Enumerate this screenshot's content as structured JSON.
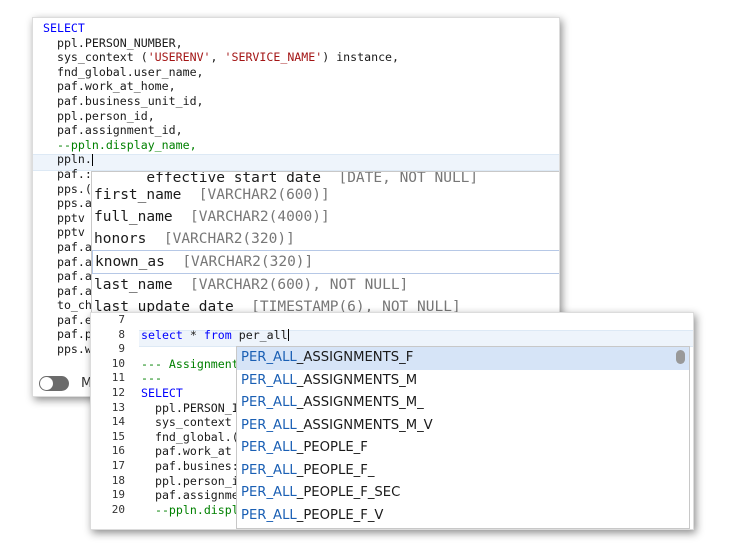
{
  "editor1": {
    "lines": [
      {
        "parts": [
          {
            "t": "SELECT",
            "c": "kw"
          }
        ]
      },
      {
        "parts": [
          {
            "t": "  ppl.PERSON_NUMBER,",
            "c": ""
          }
        ]
      },
      {
        "parts": [
          {
            "t": "  sys_context (",
            "c": ""
          },
          {
            "t": "'USERENV'",
            "c": "str"
          },
          {
            "t": ", ",
            "c": ""
          },
          {
            "t": "'SERVICE_NAME'",
            "c": "str"
          },
          {
            "t": ") instance,",
            "c": ""
          }
        ]
      },
      {
        "parts": [
          {
            "t": "  fnd_global.user_name,",
            "c": ""
          }
        ]
      },
      {
        "parts": [
          {
            "t": "  paf.work_at_home,",
            "c": ""
          }
        ]
      },
      {
        "parts": [
          {
            "t": "  paf.business_unit_id,",
            "c": ""
          }
        ]
      },
      {
        "parts": [
          {
            "t": "  ppl.person_id,",
            "c": ""
          }
        ]
      },
      {
        "parts": [
          {
            "t": "  paf.assignment_id,",
            "c": ""
          }
        ]
      },
      {
        "parts": [
          {
            "t": "  --ppln.display_name,",
            "c": "cm"
          }
        ]
      },
      {
        "parts": [
          {
            "t": "  ppln.",
            "c": ""
          }
        ]
      },
      {
        "parts": [
          {
            "t": "  paf.:",
            "c": ""
          }
        ]
      },
      {
        "parts": [
          {
            "t": "  pps.(",
            "c": ""
          }
        ]
      },
      {
        "parts": [
          {
            "t": "  pps.a",
            "c": ""
          }
        ]
      },
      {
        "parts": [
          {
            "t": "  pptv",
            "c": ""
          }
        ]
      },
      {
        "parts": [
          {
            "t": "  pptv",
            "c": ""
          }
        ]
      },
      {
        "parts": [
          {
            "t": "  paf.a",
            "c": ""
          }
        ]
      },
      {
        "parts": [
          {
            "t": "  paf.a",
            "c": ""
          }
        ]
      },
      {
        "parts": [
          {
            "t": "  paf.a",
            "c": ""
          }
        ]
      },
      {
        "parts": [
          {
            "t": "  paf.a",
            "c": ""
          }
        ]
      },
      {
        "parts": [
          {
            "t": "  to_ch",
            "c": ""
          }
        ]
      },
      {
        "parts": [
          {
            "t": "  paf.e",
            "c": ""
          }
        ]
      },
      {
        "parts": [
          {
            "t": "  paf.p",
            "c": ""
          }
        ]
      },
      {
        "parts": [
          {
            "t": "  pps.w",
            "c": ""
          }
        ]
      }
    ],
    "toggle_label": "M",
    "suggest": {
      "partial": {
        "name": "effective_start_date",
        "type": "[DATE, NOT NULL]"
      },
      "items": [
        {
          "name": "first_name",
          "type": "[VARCHAR2(600)]"
        },
        {
          "name": "full_name",
          "type": "[VARCHAR2(4000)]"
        },
        {
          "name": "honors",
          "type": "[VARCHAR2(320)]"
        },
        {
          "name": "known_as",
          "type": "[VARCHAR2(320)]"
        },
        {
          "name": "last_name",
          "type": "[VARCHAR2(600), NOT NULL]"
        },
        {
          "name": "last_update_date",
          "type": "[TIMESTAMP(6), NOT NULL]"
        }
      ],
      "selected_index": 3
    }
  },
  "editor2": {
    "line_numbers": [
      "7",
      "8",
      "9",
      "10",
      "11",
      "12",
      "13",
      "14",
      "15",
      "16",
      "17",
      "18",
      "19",
      "20"
    ],
    "lines": [
      {
        "parts": [
          {
            "t": "",
            "c": ""
          }
        ]
      },
      {
        "parts": [
          {
            "t": "select",
            "c": "kw"
          },
          {
            "t": " * ",
            "c": ""
          },
          {
            "t": "from",
            "c": "kw"
          },
          {
            "t": " per_all",
            "c": ""
          }
        ]
      },
      {
        "parts": [
          {
            "t": "",
            "c": ""
          }
        ]
      },
      {
        "parts": [
          {
            "t": "--- Assignment",
            "c": "cm"
          }
        ]
      },
      {
        "parts": [
          {
            "t": "---",
            "c": "cm"
          }
        ]
      },
      {
        "parts": [
          {
            "t": "SELECT",
            "c": "kw"
          }
        ]
      },
      {
        "parts": [
          {
            "t": "  ppl.PERSON_I",
            "c": ""
          }
        ]
      },
      {
        "parts": [
          {
            "t": "  sys_context",
            "c": ""
          }
        ]
      },
      {
        "parts": [
          {
            "t": "  fnd_global.(",
            "c": ""
          }
        ]
      },
      {
        "parts": [
          {
            "t": "  paf.work_at",
            "c": ""
          }
        ]
      },
      {
        "parts": [
          {
            "t": "  paf.busines:",
            "c": ""
          }
        ]
      },
      {
        "parts": [
          {
            "t": "  ppl.person_i",
            "c": ""
          }
        ]
      },
      {
        "parts": [
          {
            "t": "  paf.assignme",
            "c": ""
          }
        ]
      },
      {
        "parts": [
          {
            "t": "  --ppln.displ",
            "c": "cm"
          }
        ]
      }
    ],
    "suggest": {
      "match": "PER_ALL",
      "items": [
        "_ASSIGNMENTS_F",
        "_ASSIGNMENTS_M",
        "_ASSIGNMENTS_M_",
        "_ASSIGNMENTS_M_V",
        "_PEOPLE_F",
        "_PEOPLE_F_",
        "_PEOPLE_F_SEC",
        "_PEOPLE_F_V"
      ],
      "selected_index": 0
    }
  }
}
